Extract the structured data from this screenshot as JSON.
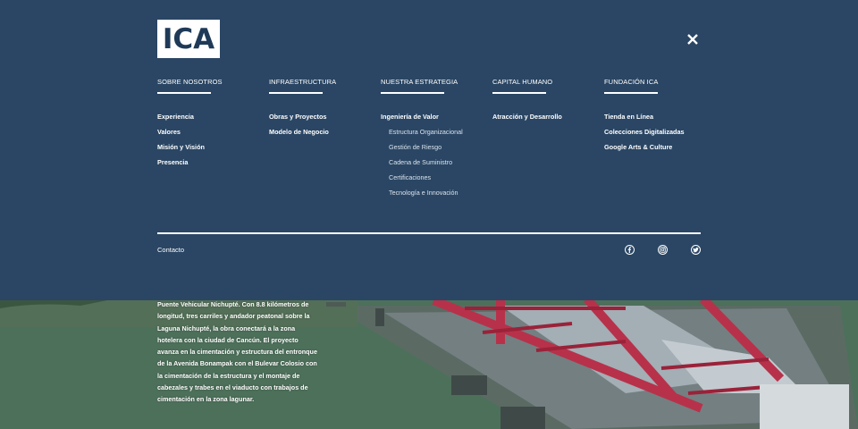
{
  "brand": {
    "logo_text": "ICA"
  },
  "menu": {
    "columns": [
      {
        "title": "SOBRE NOSOTROS",
        "items": [
          {
            "label": "Experiencia"
          },
          {
            "label": "Valores"
          },
          {
            "label": "Misión y Visión"
          },
          {
            "label": "Presencia"
          }
        ],
        "subitems": []
      },
      {
        "title": "INFRAESTRUCTURA",
        "items": [
          {
            "label": "Obras y Proyectos"
          },
          {
            "label": "Modelo de Negocio"
          }
        ],
        "subitems": []
      },
      {
        "title": "NUESTRA ESTRATEGIA",
        "items": [
          {
            "label": "Ingeniería de Valor"
          }
        ],
        "subitems": [
          {
            "label": "Estructura Organizacional"
          },
          {
            "label": "Gestión de Riesgo"
          },
          {
            "label": "Cadena de Suministro"
          },
          {
            "label": "Certificaciones"
          },
          {
            "label": "Tecnología e Innovación"
          }
        ]
      },
      {
        "title": "CAPITAL HUMANO",
        "items": [
          {
            "label": "Atracción y Desarrollo"
          }
        ],
        "subitems": []
      },
      {
        "title": "FUNDACIÓN ICA",
        "items": [
          {
            "label": "Tienda en Línea"
          },
          {
            "label": "Colecciones Digitalizadas"
          },
          {
            "label": "Google Arts & Culture"
          }
        ],
        "subitems": []
      }
    ]
  },
  "footer": {
    "contact_label": "Contacto",
    "social_icons": [
      "facebook-icon",
      "instagram-icon",
      "twitter-icon"
    ]
  },
  "hero": {
    "caption": "Puente Vehicular Nichupté. Con 8.8 kilómetros de longitud, tres carriles y andador peatonal sobre la Laguna Nichupté, la obra conectará a la zona hotelera con la ciudad de Cancún. El proyecto avanza en la cimentación y estructura del entronque de la Avenida Bonampak con el Bulevar Colosio con la cimentación de la estructura y el montaje de cabezales y trabes en el viaducto con trabajos de cimentación en la zona lagunar."
  },
  "colors": {
    "overlay": "#2a4664",
    "text": "#ffffff",
    "accent_structure": "#b8314a"
  }
}
